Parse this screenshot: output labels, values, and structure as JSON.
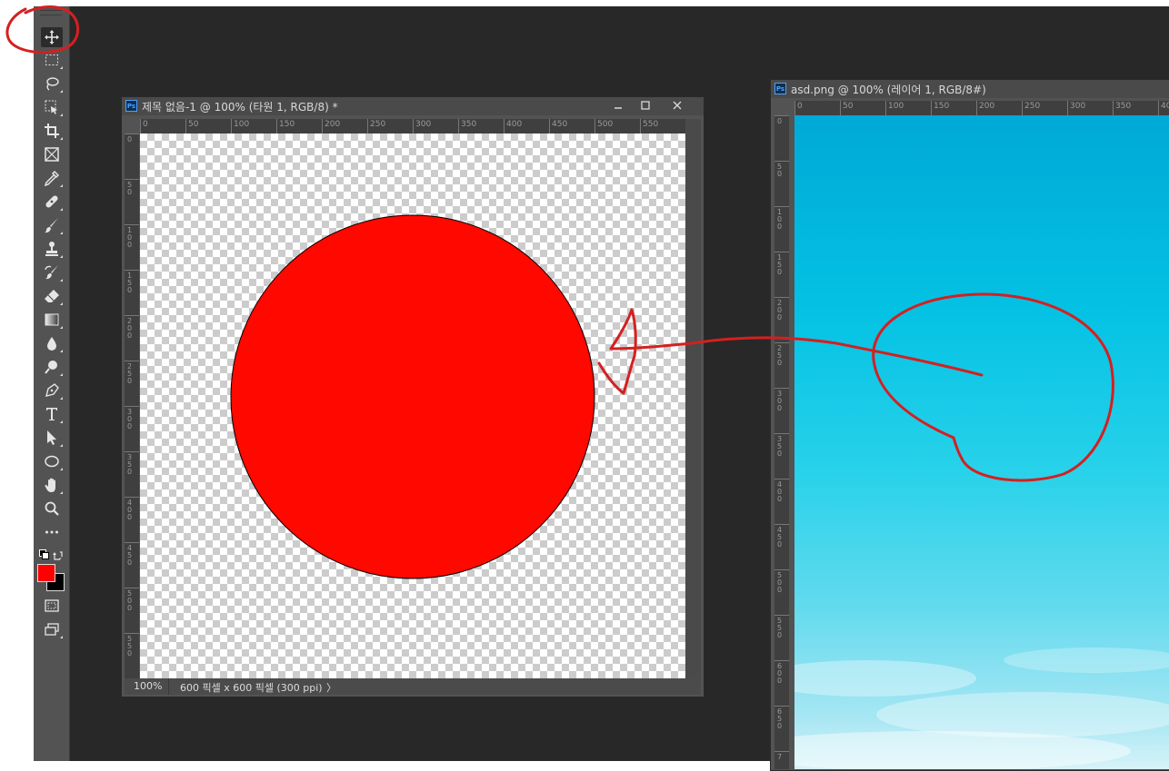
{
  "toolbox": {
    "tools": [
      {
        "id": "move",
        "icon": "move-icon",
        "active": true
      },
      {
        "id": "marquee",
        "icon": "rect-marquee-icon"
      },
      {
        "id": "lasso",
        "icon": "lasso-icon"
      },
      {
        "id": "object-select",
        "icon": "object-select-icon"
      },
      {
        "id": "crop",
        "icon": "crop-icon"
      },
      {
        "id": "frame",
        "icon": "frame-icon"
      },
      {
        "id": "eyedropper",
        "icon": "eyedropper-icon"
      },
      {
        "id": "healing",
        "icon": "healing-brush-icon"
      },
      {
        "id": "brush",
        "icon": "brush-icon"
      },
      {
        "id": "stamp",
        "icon": "clone-stamp-icon"
      },
      {
        "id": "history-brush",
        "icon": "history-brush-icon"
      },
      {
        "id": "eraser",
        "icon": "eraser-icon"
      },
      {
        "id": "gradient",
        "icon": "gradient-icon"
      },
      {
        "id": "blur",
        "icon": "blur-drop-icon"
      },
      {
        "id": "dodge",
        "icon": "dodge-icon"
      },
      {
        "id": "pen",
        "icon": "pen-icon"
      },
      {
        "id": "type",
        "icon": "type-icon"
      },
      {
        "id": "path-select",
        "icon": "path-select-icon"
      },
      {
        "id": "ellipse",
        "icon": "ellipse-icon"
      },
      {
        "id": "hand",
        "icon": "hand-icon"
      },
      {
        "id": "zoom",
        "icon": "zoom-icon"
      },
      {
        "id": "more",
        "icon": "more-icon"
      }
    ],
    "foreground_color": "#ff0000",
    "background_color": "#000000"
  },
  "doc1": {
    "title": "제목 없음-1 @ 100% (타원 1, RGB/8) *",
    "ruler_h": [
      "0",
      "50",
      "100",
      "150",
      "200",
      "250",
      "300",
      "350",
      "400",
      "450",
      "500",
      "550"
    ],
    "ruler_v": [
      "0",
      "50",
      "100",
      "150",
      "200",
      "250",
      "300",
      "350",
      "400",
      "450",
      "500",
      "550"
    ],
    "zoom": "100%",
    "doc_size": "600 픽셀 x 600 픽셀 (300 ppi)",
    "status_arrow": "〉",
    "shape_color": "#ff0800"
  },
  "doc2": {
    "title": "asd.png @ 100% (레이어 1, RGB/8#)",
    "ruler_h": [
      "0",
      "50",
      "100",
      "150",
      "200",
      "250",
      "300",
      "350",
      "40"
    ],
    "ruler_v": [
      "0",
      "50",
      "100",
      "150",
      "200",
      "250",
      "300",
      "350",
      "400",
      "450",
      "500",
      "550",
      "600",
      "650",
      "7"
    ]
  },
  "annotation_color": "#d42020"
}
